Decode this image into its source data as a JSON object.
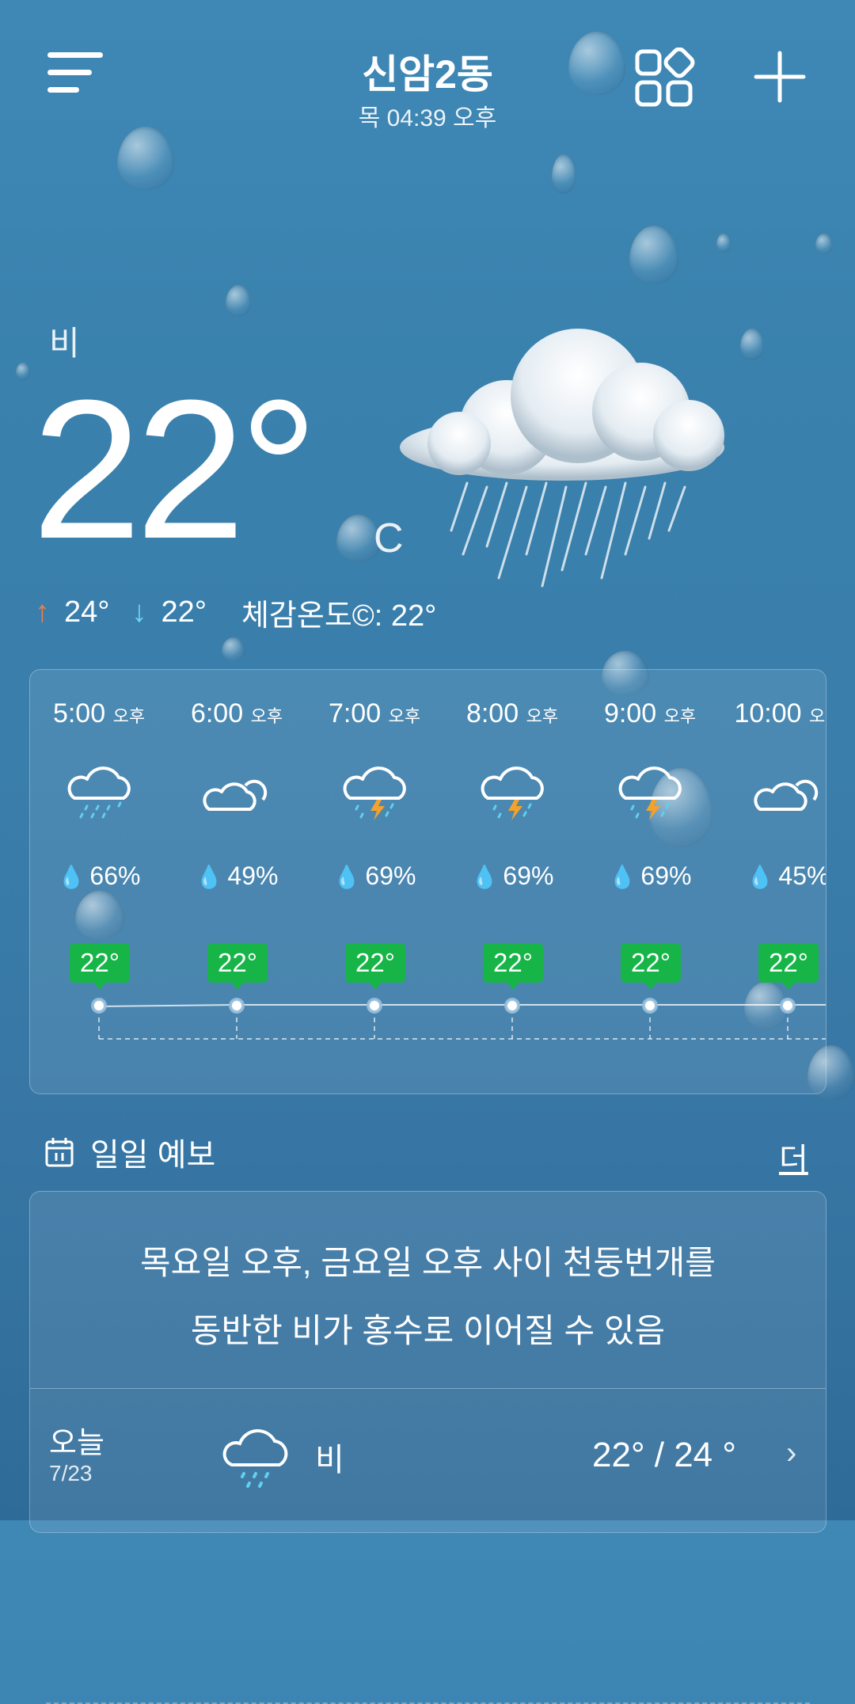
{
  "header": {
    "city": "신암2동",
    "time": "목 04:39 오후",
    "menu_icon": "menu-icon",
    "grid_icon": "widgets-icon",
    "add_icon": "plus-icon"
  },
  "current": {
    "condition": "비",
    "temp": "22°",
    "unit": "C",
    "high": "24°",
    "low": "22°",
    "feels_like": "체감온도©: 22°"
  },
  "hourly": [
    {
      "time": "5:00",
      "ampm": "오후",
      "icon": "rain-icon",
      "rain": "66%",
      "temp": "22°"
    },
    {
      "time": "6:00",
      "ampm": "오후",
      "icon": "partly-cloudy-icon",
      "rain": "49%",
      "temp": "22°"
    },
    {
      "time": "7:00",
      "ampm": "오후",
      "icon": "thunderstorm-icon",
      "rain": "69%",
      "temp": "22°"
    },
    {
      "time": "8:00",
      "ampm": "오후",
      "icon": "thunderstorm-icon",
      "rain": "69%",
      "temp": "22°"
    },
    {
      "time": "9:00",
      "ampm": "오후",
      "icon": "thunderstorm-icon",
      "rain": "69%",
      "temp": "22°"
    },
    {
      "time": "10:00",
      "ampm": "오후",
      "icon": "partly-cloudy-icon",
      "rain": "45%",
      "temp": "22°"
    }
  ],
  "daily": {
    "title": "일일 예보",
    "more": "더",
    "alert_line1": "목요일 오후, 금요일 오후 사이  천둥번개를",
    "alert_line2": "동반한 비가 홍수로 이어질 수 있음",
    "rows": [
      {
        "day": "오늘",
        "date": "7/23",
        "icon": "rain-icon",
        "condition": "비",
        "temps": "22° / 24 °"
      }
    ]
  },
  "colors": {
    "accent_badge": "#17b548",
    "high_arrow": "#f07c4a",
    "low_arrow": "#6fd6f2"
  }
}
